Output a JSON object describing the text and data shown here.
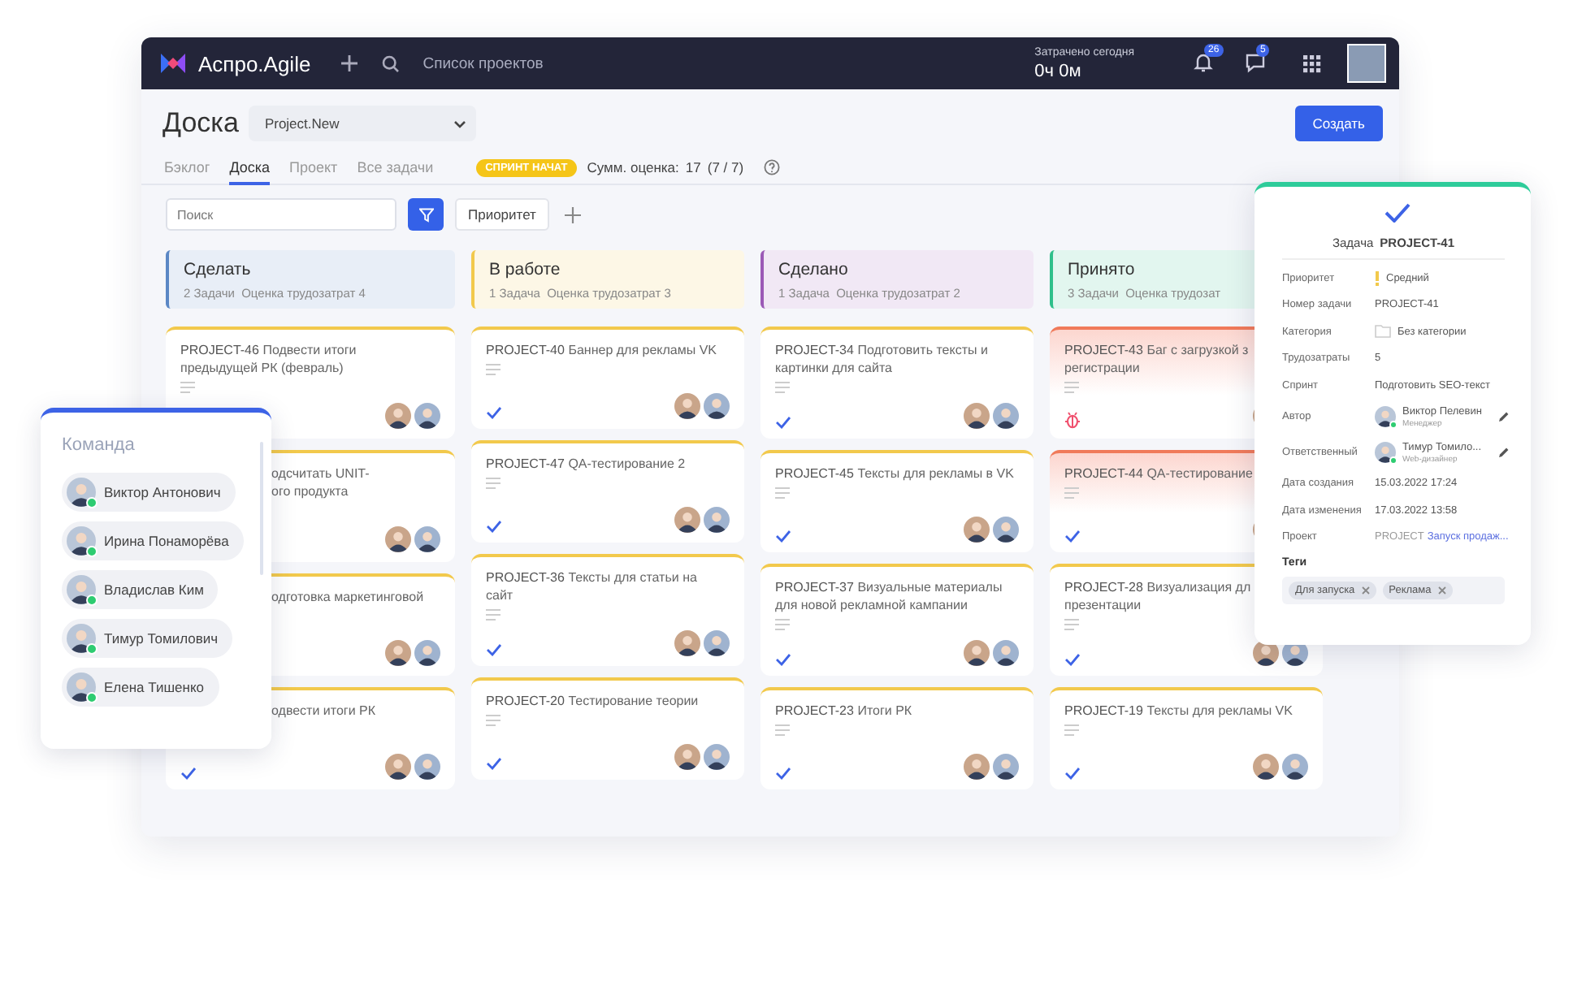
{
  "app": {
    "name": "Аспро.Agile",
    "projects_link": "Список проектов",
    "time_label": "Затрачено сегодня",
    "time_value": "0ч 0м",
    "notifications": "26",
    "messages": "5"
  },
  "page": {
    "title": "Доска",
    "project_select": "Project.New",
    "create_button": "Создать"
  },
  "tabs": [
    {
      "label": "Бэклог",
      "selected": false
    },
    {
      "label": "Доска",
      "selected": true
    },
    {
      "label": "Проект",
      "selected": false
    },
    {
      "label": "Все задачи",
      "selected": false
    }
  ],
  "sprint": {
    "badge": "СПРИНТ НАЧАТ",
    "sum_label": "Сумм. оценка:",
    "sum_value": "17",
    "sum_detail": "(7 / 7)"
  },
  "filters": {
    "search_placeholder": "Поиск",
    "priority_button": "Приоритет"
  },
  "columns": [
    {
      "title": "Сделать",
      "color": "#5b87c5",
      "count": "2 Задачи",
      "estimate": "Оценка трудозатрат 4",
      "cards": [
        {
          "kind": "task",
          "key": "PROJECT-46",
          "lines": [
            "Подвести итоги",
            "предыдущей РК (февраль)"
          ]
        },
        {
          "kind": "covered",
          "lines": [
            "одсчитать UNIT-",
            "ого продукта"
          ]
        },
        {
          "kind": "covered",
          "lines": [
            "одготовка маркетинговой"
          ]
        },
        {
          "kind": "covered",
          "lines": [
            "одвести итоги РК"
          ]
        }
      ]
    },
    {
      "title": "В работе",
      "color": "#f2c94c",
      "count": "1 Задача",
      "estimate": "Оценка трудозатрат 3",
      "cards": [
        {
          "kind": "task",
          "key": "PROJECT-40",
          "lines": [
            "Баннер для рекламы VK"
          ]
        },
        {
          "kind": "task",
          "key": "PROJECT-47",
          "lines": [
            "QA-тестирование 2"
          ]
        },
        {
          "kind": "task",
          "key": "PROJECT-36",
          "lines": [
            "Тексты для статьи на",
            "сайт"
          ]
        },
        {
          "kind": "task",
          "key": "PROJECT-20",
          "lines": [
            "Тестирование теории"
          ]
        }
      ]
    },
    {
      "title": "Сделано",
      "color": "#9b59b6",
      "count": "1 Задача",
      "estimate": "Оценка трудозатрат 2",
      "cards": [
        {
          "kind": "task",
          "key": "PROJECT-34",
          "lines": [
            "Подготовить тексты и",
            "картинки для сайта"
          ]
        },
        {
          "kind": "task",
          "key": "PROJECT-45",
          "lines": [
            "Тексты для рекламы в VK"
          ]
        },
        {
          "kind": "task",
          "key": "PROJECT-37",
          "lines": [
            "Визуальные материалы",
            "для новой рекламной кампании"
          ]
        },
        {
          "kind": "task",
          "key": "PROJECT-23",
          "lines": [
            "Итоги РК"
          ]
        }
      ]
    },
    {
      "title": "Принято",
      "color": "#2fbf8a",
      "count": "3 Задачи",
      "estimate": "Оценка трудозат",
      "cards": [
        {
          "kind": "bug",
          "key": "PROJECT-43",
          "lines": [
            "Баг с загрузкой з",
            "регистрации"
          ]
        },
        {
          "kind": "alert",
          "key": "PROJECT-44",
          "lines": [
            "QA-тестирование"
          ]
        },
        {
          "kind": "task",
          "key": "PROJECT-28",
          "lines": [
            "Визуализация дл",
            "презентации"
          ]
        },
        {
          "kind": "task",
          "key": "PROJECT-19",
          "lines": [
            "Тексты для рекламы VK"
          ]
        }
      ]
    }
  ],
  "team": {
    "title": "Команда",
    "members": [
      {
        "name": "Виктор Антонович",
        "online": true
      },
      {
        "name": "Ирина Понаморёва",
        "online": true
      },
      {
        "name": "Владислав Ким",
        "online": true
      },
      {
        "name": "Тимур Томилович",
        "online": true
      },
      {
        "name": "Елена Тишенко",
        "online": true
      }
    ]
  },
  "task_detail": {
    "label": "Задача",
    "key": "PROJECT-41",
    "rows": [
      {
        "kind": "priority",
        "label": "Приоритет",
        "value": "Средний"
      },
      {
        "kind": "text",
        "label": "Номер задачи",
        "value": "PROJECT-41"
      },
      {
        "kind": "category",
        "label": "Категория",
        "value": "Без категории"
      },
      {
        "kind": "text",
        "label": "Трудозатраты",
        "value": "5"
      },
      {
        "kind": "text",
        "label": "Спринт",
        "value": "Подготовить SEO-текст"
      },
      {
        "kind": "person",
        "label": "Автор",
        "value": "Виктор Пелевин",
        "role": "Менеджер"
      },
      {
        "kind": "person",
        "label": "Ответственный",
        "value": "Тимур Томило...",
        "role": "Web-дизайнер"
      },
      {
        "kind": "text",
        "label": "Дата создания",
        "value": "15.03.2022 17:24"
      },
      {
        "kind": "text",
        "label": "Дата изменения",
        "value": "17.03.2022 13:58"
      },
      {
        "kind": "project",
        "label": "Проект",
        "value": "PROJECT",
        "link": "Запуск продаж..."
      }
    ],
    "tags_label": "Теги",
    "tags": [
      "Для запуска",
      "Реклама"
    ]
  }
}
